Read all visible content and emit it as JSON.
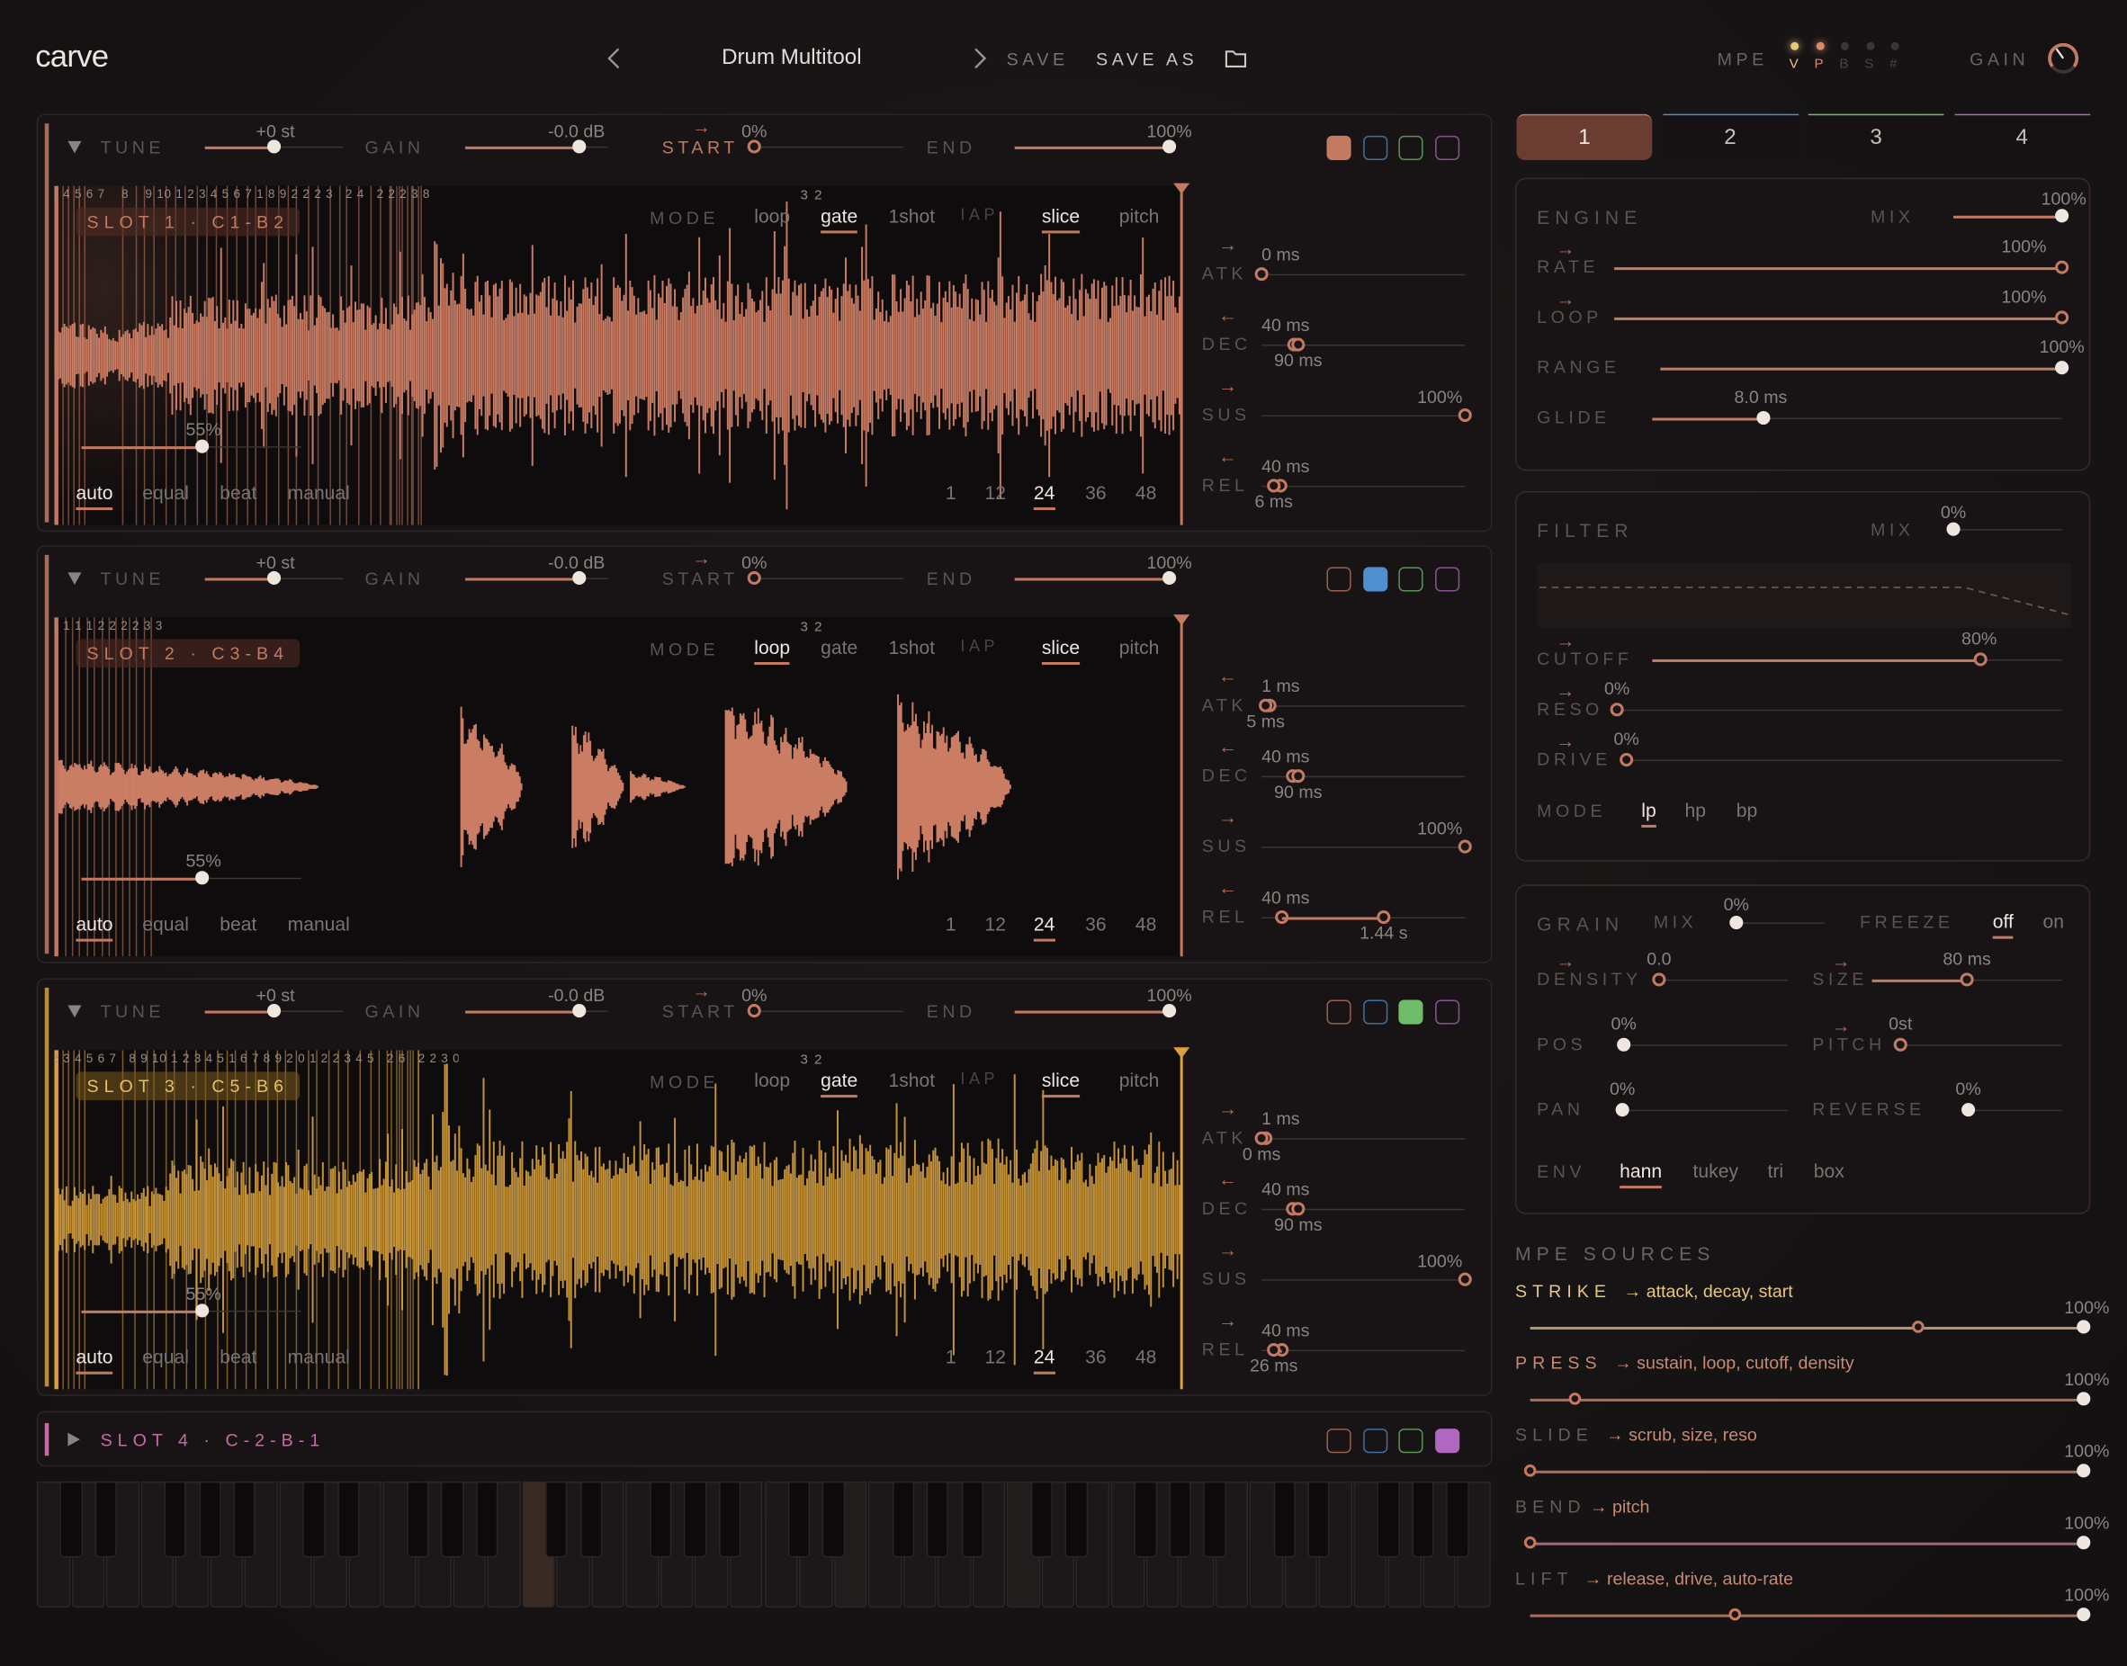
{
  "header": {
    "logo": "carve",
    "preset": "Drum Multitool",
    "prev_icon": "chevron-left-icon",
    "next_icon": "chevron-right-icon",
    "save": "SAVE",
    "save_as": "SAVE AS",
    "folder_icon": "folder-icon",
    "mpe": "MPE",
    "mpe_dims": [
      "V",
      "P",
      "B",
      "S",
      "#"
    ],
    "gain": "GAIN"
  },
  "tabs": [
    "1",
    "2",
    "3",
    "4"
  ],
  "slots": [
    {
      "name": "SLOT 1 · C1-B2",
      "color": "#c27a61",
      "tune": "+0 st",
      "gain": "-0.0 dB",
      "start": "0%",
      "end": "100%",
      "mode_selected": [
        "gate",
        "slice"
      ],
      "slice_amount": "55%",
      "slice_mode": "auto",
      "slice_count": "24",
      "atk": [
        "0 ms"
      ],
      "dec": [
        "40 ms",
        "90 ms"
      ],
      "sus": "100%",
      "rel": [
        "40 ms",
        "6 ms"
      ],
      "marker_labels": "3 4 5 6 7    8    9 10 1 2 3 4 5 6 7 1 8 9 2 2 2 3   2 4   2 2 2 3 8",
      "extra_label": "3 2",
      "swatch": 0
    },
    {
      "name": "SLOT 2 · C3-B4",
      "color": "#c27a61",
      "tune": "+0 st",
      "gain": "-0.0 dB",
      "start": "0%",
      "end": "100%",
      "mode_selected": [
        "loop",
        "slice"
      ],
      "slice_amount": "55%",
      "slice_mode": "auto",
      "slice_count": "24",
      "atk": [
        "1 ms",
        "5 ms"
      ],
      "dec": [
        "40 ms",
        "90 ms"
      ],
      "sus": "100%",
      "rel": [
        "40 ms",
        "1.44 s"
      ],
      "marker_labels": "3 1 1 1 2 2 2 2 3 3",
      "extra_label": "3 2",
      "swatch": 1
    },
    {
      "name": "SLOT 3 · C5-B6",
      "color": "#d9a23e",
      "tune": "+0 st",
      "gain": "-0.0 dB",
      "start": "0%",
      "end": "100%",
      "mode_selected": [
        "gate",
        "slice"
      ],
      "slice_amount": "55%",
      "slice_mode": "auto",
      "slice_count": "24",
      "atk": [
        "1 ms",
        "0 ms"
      ],
      "dec": [
        "40 ms",
        "90 ms"
      ],
      "sus": "100%",
      "rel": [
        "40 ms",
        "26 ms"
      ],
      "marker_labels": "2 3 4 5 6 7   8 9 10 1 2 3 4 5 1 6 7 8 9 2 0 1 2 2 3 4 5   2 6   2 2 3 0",
      "extra_label": "3 2",
      "swatch": 2
    }
  ],
  "slot_labels": {
    "tune": "TUNE",
    "gain": "GAIN",
    "start": "START",
    "end": "END",
    "mode": "MODE",
    "modes": [
      "loop",
      "gate",
      "1shot",
      "IAP",
      "slice",
      "pitch"
    ],
    "slice_modes": [
      "auto",
      "equal",
      "beat",
      "manual"
    ],
    "counts": [
      "1",
      "12",
      "24",
      "36",
      "48"
    ],
    "atk": "ATK",
    "dec": "DEC",
    "sus": "SUS",
    "rel": "REL"
  },
  "slot4": {
    "name": "SLOT 4 · C-2-B-1",
    "color": "#c76aa6"
  },
  "swatch_colors": [
    "#c27a61",
    "#4f8fd0",
    "#6fbd6b",
    "#b067c0"
  ],
  "engine": {
    "title": "ENGINE",
    "mix_label": "MIX",
    "mix": "100%",
    "rate_label": "RATE",
    "rate": "100%",
    "loop_label": "LOOP",
    "loop": "100%",
    "range_label": "RANGE",
    "range": "100%",
    "glide_label": "GLIDE",
    "glide": "8.0 ms"
  },
  "filter": {
    "title": "FILTER",
    "mix_label": "MIX",
    "mix": "0%",
    "cutoff_label": "CUTOFF",
    "cutoff": "80%",
    "reso_label": "RESO",
    "reso": "0%",
    "drive_label": "DRIVE",
    "drive": "0%",
    "mode_label": "MODE",
    "modes": [
      "lp",
      "hp",
      "bp"
    ],
    "selected": "lp"
  },
  "grain": {
    "title": "GRAIN",
    "mix_label": "MIX",
    "mix": "0%",
    "freeze_label": "FREEZE",
    "freeze_opts": [
      "off",
      "on"
    ],
    "density_label": "DENSITY",
    "density": "0.0",
    "size_label": "SIZE",
    "size": "80 ms",
    "pos_label": "POS",
    "pos": "0%",
    "pitch_label": "PITCH",
    "pitch": "0st",
    "pan_label": "PAN",
    "pan": "0%",
    "reverse_label": "REVERSE",
    "reverse": "0%",
    "env_label": "ENV",
    "envs": [
      "hann",
      "tukey",
      "tri",
      "box"
    ],
    "env_selected": "hann"
  },
  "mpe_sources": {
    "title": "MPE SOURCES",
    "rows": [
      {
        "name": "STRIKE",
        "targets": "→ attack, decay, start",
        "value": "100%",
        "pos": 0.7
      },
      {
        "name": "PRESS",
        "targets": "→ sustain, loop, cutoff, density",
        "value": "100%",
        "pos": 0.08
      },
      {
        "name": "SLIDE",
        "targets": "→ scrub, size, reso",
        "value": "100%",
        "pos": 0.0
      },
      {
        "name": "BEND",
        "targets": "→ pitch",
        "value": "100%",
        "pos": 0.0
      },
      {
        "name": "LIFT",
        "targets": "→ release, drive, auto-rate",
        "value": "100%",
        "pos": 0.37
      }
    ]
  }
}
